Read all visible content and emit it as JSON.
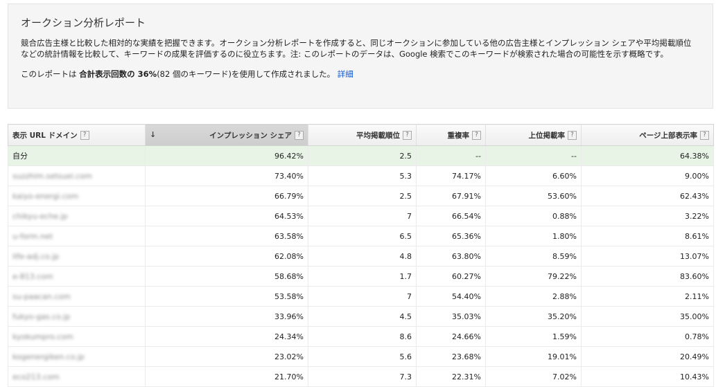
{
  "report": {
    "title": "オークション分析レポート",
    "description": "競合広告主様と比較した相対的な実績を把握できます。オークション分析レポートを作成すると、同じオークションに参加している他の広告主様とインプレッション シェアや平均掲載順位などの統計情報を比較して、キーワードの成果を評価するのに役立ちます。注: このレポートのデータは、Google 検索でこのキーワードが検索された場合の可能性を示す概略です。",
    "summary_prefix": "このレポートは",
    "summary_bold": "合計表示回数の 36%",
    "summary_suffix": "(82 個のキーワード)を使用して作成されました。",
    "details_link": "詳細"
  },
  "table": {
    "sort_arrow": "↓",
    "help_glyph": "?",
    "columns": [
      {
        "key": "domain",
        "label": "表示 URL ドメイン"
      },
      {
        "key": "impression_share",
        "label": "インプレッション シェア",
        "sorted": true
      },
      {
        "key": "avg_position",
        "label": "平均掲載順位"
      },
      {
        "key": "overlap_rate",
        "label": "重複率"
      },
      {
        "key": "position_above_rate",
        "label": "上位掲載率"
      },
      {
        "key": "top_of_page_rate",
        "label": "ページ上部表示率"
      }
    ],
    "rows": [
      {
        "domain": "自分",
        "self": true,
        "impression_share": "96.42%",
        "avg_position": "2.5",
        "overlap_rate": "--",
        "position_above_rate": "--",
        "top_of_page_rate": "64.38%"
      },
      {
        "domain": "suzzhim.setsuei.com",
        "impression_share": "73.40%",
        "avg_position": "5.3",
        "overlap_rate": "74.17%",
        "position_above_rate": "6.60%",
        "top_of_page_rate": "9.00%"
      },
      {
        "domain": "kaiyo-energi.com",
        "impression_share": "66.79%",
        "avg_position": "2.5",
        "overlap_rate": "67.91%",
        "position_above_rate": "53.60%",
        "top_of_page_rate": "62.43%"
      },
      {
        "domain": "chikyu-eche.jp",
        "impression_share": "64.53%",
        "avg_position": "7",
        "overlap_rate": "66.54%",
        "position_above_rate": "0.88%",
        "top_of_page_rate": "3.22%"
      },
      {
        "domain": "u-form.net",
        "impression_share": "63.58%",
        "avg_position": "6.5",
        "overlap_rate": "65.36%",
        "position_above_rate": "1.80%",
        "top_of_page_rate": "8.61%"
      },
      {
        "domain": "life-adj.co.jp",
        "impression_share": "62.08%",
        "avg_position": "4.8",
        "overlap_rate": "63.80%",
        "position_above_rate": "8.59%",
        "top_of_page_rate": "13.07%"
      },
      {
        "domain": "e-813.com",
        "impression_share": "58.68%",
        "avg_position": "1.7",
        "overlap_rate": "60.27%",
        "position_above_rate": "79.22%",
        "top_of_page_rate": "83.60%"
      },
      {
        "domain": "su-paacan.com",
        "impression_share": "53.58%",
        "avg_position": "7",
        "overlap_rate": "54.40%",
        "position_above_rate": "2.88%",
        "top_of_page_rate": "2.11%"
      },
      {
        "domain": "fukyo-gas.co.jp",
        "impression_share": "33.96%",
        "avg_position": "4.5",
        "overlap_rate": "35.03%",
        "position_above_rate": "35.20%",
        "top_of_page_rate": "35.00%"
      },
      {
        "domain": "kyokumpro.com",
        "impression_share": "24.34%",
        "avg_position": "8.6",
        "overlap_rate": "24.66%",
        "position_above_rate": "1.59%",
        "top_of_page_rate": "0.78%"
      },
      {
        "domain": "kogenergiken.co.jp",
        "impression_share": "23.02%",
        "avg_position": "5.6",
        "overlap_rate": "23.68%",
        "position_above_rate": "19.01%",
        "top_of_page_rate": "20.49%"
      },
      {
        "domain": "eco213.com",
        "impression_share": "21.70%",
        "avg_position": "7.3",
        "overlap_rate": "22.31%",
        "position_above_rate": "7.02%",
        "top_of_page_rate": "10.43%"
      }
    ]
  }
}
